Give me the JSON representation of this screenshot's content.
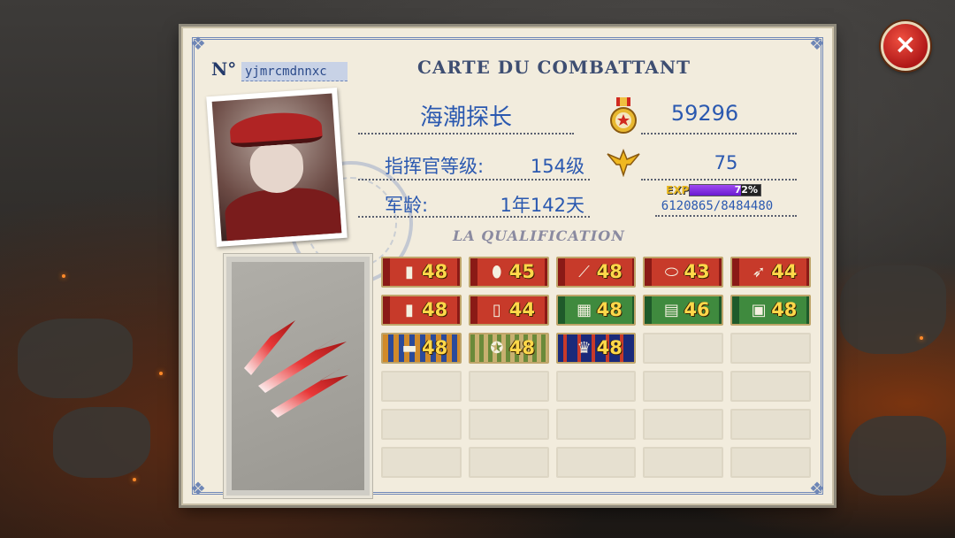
{
  "card": {
    "number_label": "N°",
    "number_value": "yjmrcmdnnxc",
    "title": "CARTE DU COMBATTANT",
    "player_name": "海潮探长",
    "power_value": "59296",
    "commander_level_label": "指挥官等级:",
    "commander_level_value": "154级",
    "rank_value": "75",
    "service_age_label": "军龄:",
    "service_age_value": "1年142天",
    "exp": {
      "label": "EXP",
      "percent_text": "72%",
      "percent": 72,
      "progress_text": "6120865/8484480"
    },
    "qualification_title": "LA QUALIFICATION"
  },
  "badges": [
    {
      "icon": "bullet-icon",
      "value": "48",
      "style": "red"
    },
    {
      "icon": "shell-icon",
      "value": "45",
      "style": "red"
    },
    {
      "icon": "rifle-icon",
      "value": "48",
      "style": "red"
    },
    {
      "icon": "ammo-icon",
      "value": "43",
      "style": "red"
    },
    {
      "icon": "rocket-icon",
      "value": "44",
      "style": "red"
    },
    {
      "icon": "bullet-icon",
      "value": "48",
      "style": "red"
    },
    {
      "icon": "cartridge-icon",
      "value": "44",
      "style": "red"
    },
    {
      "icon": "map-icon",
      "value": "48",
      "style": "green"
    },
    {
      "icon": "blueprint-icon",
      "value": "46",
      "style": "green"
    },
    {
      "icon": "crate-icon",
      "value": "48",
      "style": "green"
    },
    {
      "icon": "tank-icon",
      "value": "48",
      "style": "orange"
    },
    {
      "icon": "medal-icon",
      "value": "48",
      "style": "olive"
    },
    {
      "icon": "trophy-icon",
      "value": "48",
      "style": "navy"
    }
  ],
  "colors": {
    "card_bg": "#f2ecdd",
    "text_blue": "#2b59b0",
    "badge_number": "#ffd84a",
    "close_button": "#d02a20"
  },
  "close_button_label": "×"
}
